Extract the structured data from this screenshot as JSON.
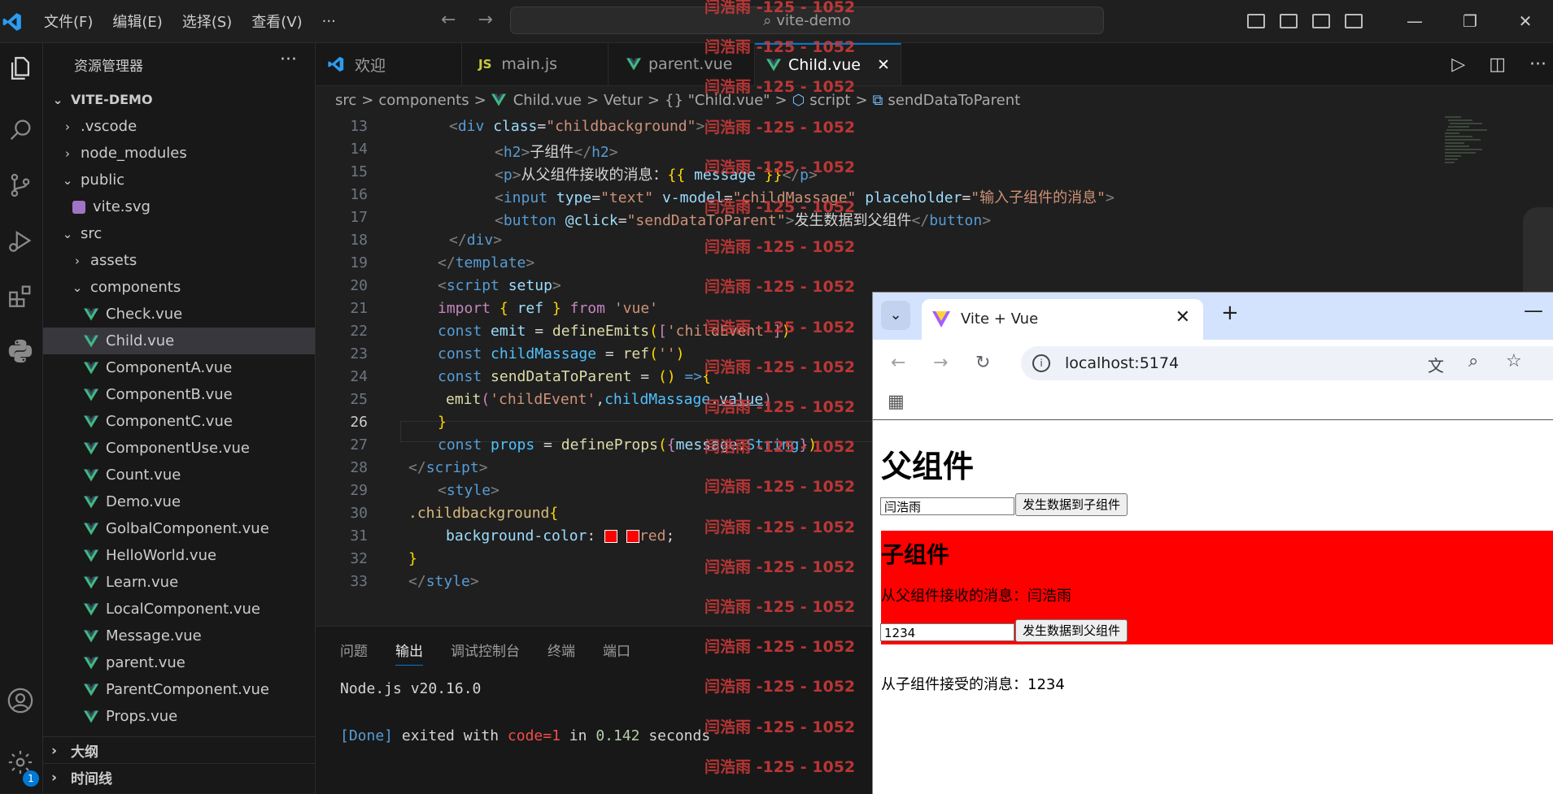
{
  "title_bar": {
    "menu": [
      "文件(F)",
      "编辑(E)",
      "选择(S)",
      "查看(V)",
      "···"
    ],
    "command_center": "vite-demo",
    "window_buttons": [
      "—",
      "❐",
      "✕"
    ]
  },
  "explorer": {
    "title": "资源管理器",
    "more": "···",
    "root": "VITE-DEMO",
    "items": [
      {
        "label": ".vscode",
        "kind": "folder",
        "open": false,
        "depth": 1
      },
      {
        "label": "node_modules",
        "kind": "folder",
        "open": false,
        "depth": 1
      },
      {
        "label": "public",
        "kind": "folder",
        "open": true,
        "depth": 1
      },
      {
        "label": "vite.svg",
        "kind": "svg",
        "depth": 2
      },
      {
        "label": "src",
        "kind": "folder",
        "open": true,
        "depth": 1
      },
      {
        "label": "assets",
        "kind": "folder",
        "open": false,
        "depth": 2
      },
      {
        "label": "components",
        "kind": "folder",
        "open": true,
        "depth": 2
      },
      {
        "label": "Check.vue",
        "kind": "vue",
        "depth": 3
      },
      {
        "label": "Child.vue",
        "kind": "vue",
        "depth": 3,
        "selected": true
      },
      {
        "label": "ComponentA.vue",
        "kind": "vue",
        "depth": 3
      },
      {
        "label": "ComponentB.vue",
        "kind": "vue",
        "depth": 3
      },
      {
        "label": "ComponentC.vue",
        "kind": "vue",
        "depth": 3
      },
      {
        "label": "ComponentUse.vue",
        "kind": "vue",
        "depth": 3
      },
      {
        "label": "Count.vue",
        "kind": "vue",
        "depth": 3
      },
      {
        "label": "Demo.vue",
        "kind": "vue",
        "depth": 3
      },
      {
        "label": "GolbalComponent.vue",
        "kind": "vue",
        "depth": 3
      },
      {
        "label": "HelloWorld.vue",
        "kind": "vue",
        "depth": 3
      },
      {
        "label": "Learn.vue",
        "kind": "vue",
        "depth": 3
      },
      {
        "label": "LocalComponent.vue",
        "kind": "vue",
        "depth": 3
      },
      {
        "label": "Message.vue",
        "kind": "vue",
        "depth": 3
      },
      {
        "label": "parent.vue",
        "kind": "vue",
        "depth": 3
      },
      {
        "label": "ParentComponent.vue",
        "kind": "vue",
        "depth": 3
      },
      {
        "label": "Props.vue",
        "kind": "vue",
        "depth": 3
      }
    ],
    "outline": "大纲",
    "timeline": "时间线"
  },
  "activity_badge": "1",
  "tabs": [
    {
      "label": "欢迎",
      "icon": "vscode-icon"
    },
    {
      "label": "main.js",
      "icon": "js-icon"
    },
    {
      "label": "parent.vue",
      "icon": "vue-icon"
    },
    {
      "label": "Child.vue",
      "icon": "vue-icon",
      "active": true
    }
  ],
  "breadcrumb": [
    "src",
    ">",
    "components",
    ">",
    "Child.vue",
    ">",
    "Vetur",
    ">",
    "{} \"Child.vue\"",
    ">",
    "script",
    ">",
    "sendDataToParent"
  ],
  "editor": {
    "line_numbers": [
      "13",
      "14",
      "15",
      "16",
      "17",
      "18",
      "19",
      "20",
      "21",
      "22",
      "23",
      "24",
      "25",
      "26",
      "27",
      "28",
      "29",
      "30",
      "31",
      "32",
      "33"
    ],
    "current_line": "26"
  },
  "panel": {
    "tabs": [
      "问题",
      "输出",
      "调试控制台",
      "终端",
      "端口"
    ],
    "active_tab": "输出",
    "line1": "Node.js v20.16.0",
    "done": "[Done]",
    "exited": " exited with ",
    "code": "code=1",
    "in": " in ",
    "secs": "0.142",
    "seconds": " seconds"
  },
  "watermark": "闫浩雨 -125 - 1052",
  "browser": {
    "tab_title": "Vite + Vue",
    "url": "localhost:5174",
    "page": {
      "parent_heading": "父组件",
      "parent_input": "闫浩雨",
      "parent_button": "发生数据到子组件",
      "child_heading": "子组件",
      "child_message": "从父组件接收的消息：闫浩雨",
      "child_input": "1234",
      "child_button": "发生数据到父组件",
      "received": "从子组件接受的消息：1234"
    }
  },
  "colors": {
    "accent": "#0078d4",
    "child_bg": "#ff0000",
    "watermark": "#d13a3a"
  }
}
